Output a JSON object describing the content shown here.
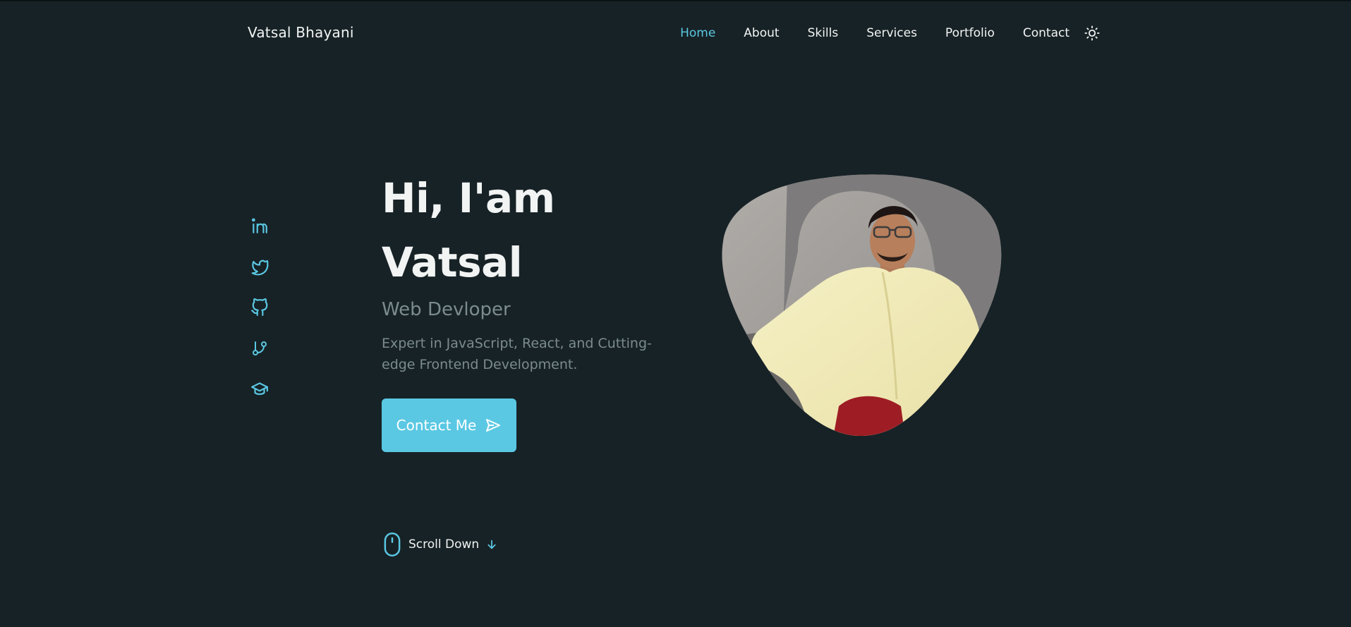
{
  "header": {
    "logo": "Vatsal Bhayani",
    "nav": [
      {
        "label": "Home",
        "active": true
      },
      {
        "label": "About",
        "active": false
      },
      {
        "label": "Skills",
        "active": false
      },
      {
        "label": "Services",
        "active": false
      },
      {
        "label": "Portfolio",
        "active": false
      },
      {
        "label": "Contact",
        "active": false
      }
    ],
    "theme_toggle_icon": "sun-icon"
  },
  "social": [
    {
      "icon": "linkedin-icon"
    },
    {
      "icon": "twitter-icon"
    },
    {
      "icon": "github-icon"
    },
    {
      "icon": "git-branch-icon"
    },
    {
      "icon": "graduation-cap-icon"
    }
  ],
  "hero": {
    "title_line1": "Hi, I'am",
    "title_line2": "Vatsal",
    "role": "Web Devloper",
    "description": "Expert in JavaScript, React, and Cutting-edge Frontend Development.",
    "cta_label": "Contact Me",
    "cta_icon": "send-icon"
  },
  "scroll": {
    "label": "Scroll Down",
    "mouse_icon": "mouse-icon",
    "arrow_icon": "arrow-down-icon"
  },
  "colors": {
    "background": "#172226",
    "accent": "#5ac8e3",
    "text": "#f2f4f4",
    "muted": "#7b8b8f"
  }
}
